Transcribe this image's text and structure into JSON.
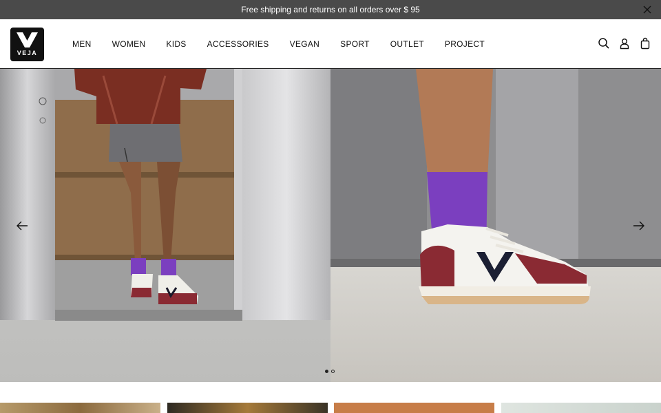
{
  "announcement": {
    "text": "Free shipping and returns on all orders over $ 95",
    "close_icon": "close-icon"
  },
  "brand": {
    "name": "VEJA",
    "logo_color": "#111111"
  },
  "nav": {
    "items": [
      {
        "label": "MEN"
      },
      {
        "label": "WOMEN"
      },
      {
        "label": "KIDS"
      },
      {
        "label": "ACCESSORIES"
      },
      {
        "label": "VEGAN"
      },
      {
        "label": "SPORT"
      },
      {
        "label": "OUTLET"
      },
      {
        "label": "PROJECT"
      }
    ]
  },
  "tools": {
    "search_icon": "search-icon",
    "account_icon": "account-icon",
    "bag_icon": "bag-icon"
  },
  "hero": {
    "prev_icon": "arrow-left-icon",
    "next_icon": "arrow-right-icon",
    "slides_total": 2,
    "active_slide": 1
  },
  "colors": {
    "announcement_bg": "#4a4a4a",
    "sock_purple": "#7b3fbf",
    "sneaker_burgundy": "#8a2a33"
  }
}
